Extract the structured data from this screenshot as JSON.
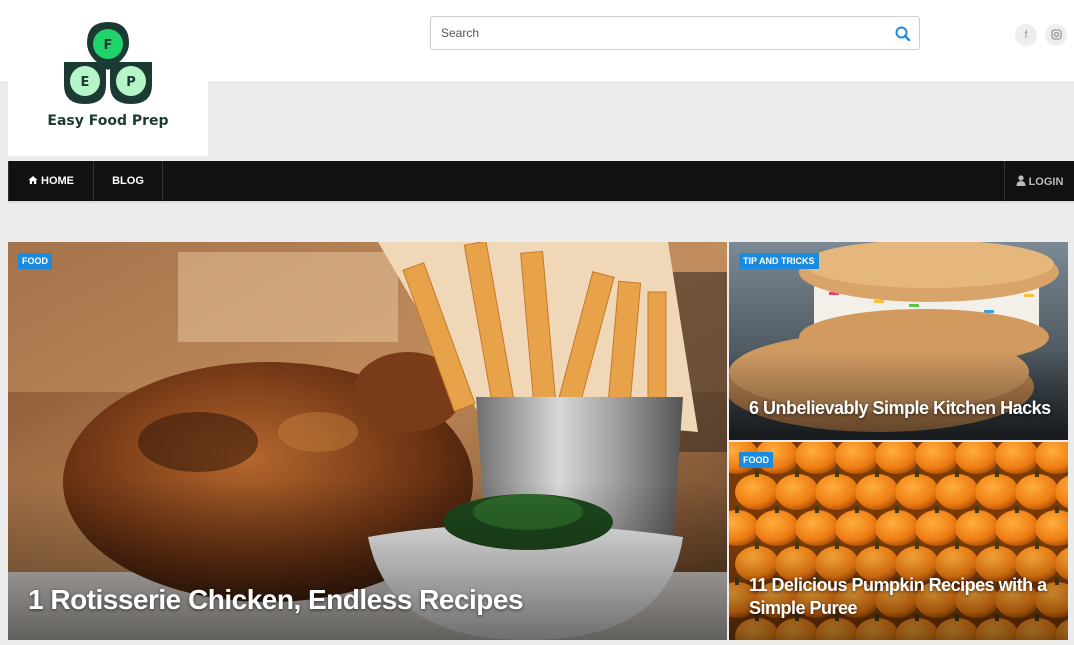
{
  "site": {
    "logo_letters": [
      "F",
      "E",
      "P"
    ],
    "logo_text": "Easy Food Prep"
  },
  "search": {
    "placeholder": "Search",
    "icon": "search-icon"
  },
  "social": [
    {
      "name": "facebook-icon",
      "glyph": "f"
    },
    {
      "name": "instagram-icon",
      "glyph": "◎"
    }
  ],
  "nav": {
    "home_label": "HOME",
    "blog_label": "BLOG",
    "login_label": "LOGIN"
  },
  "featured": {
    "main": {
      "category": "FOOD",
      "title": "1 Rotisserie Chicken, Endless Recipes"
    },
    "side": [
      {
        "category": "TIP AND TRICKS",
        "title": "6 Unbelievably Simple Kitchen Hacks"
      },
      {
        "category": "FOOD",
        "title": "11 Delicious Pumpkin Recipes with a Simple Puree"
      }
    ]
  },
  "colors": {
    "accent": "#1b8be0",
    "nav_bg": "#111111",
    "logo_green": "#1fd36a",
    "logo_dark": "#1b3a33"
  }
}
